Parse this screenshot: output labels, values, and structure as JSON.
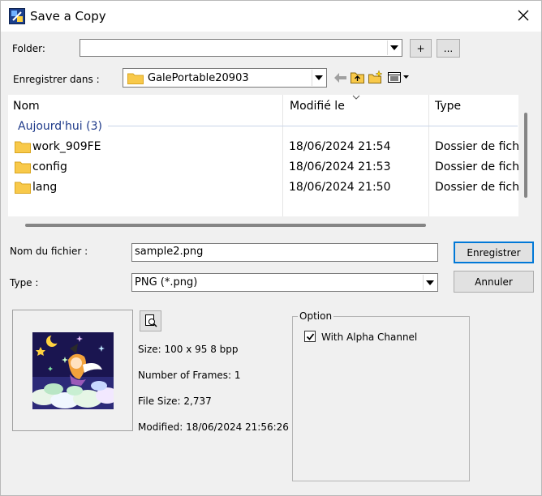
{
  "window": {
    "title": "Save a Copy"
  },
  "folder": {
    "label": "Folder:",
    "value": "",
    "add_label": "+",
    "browse_label": "..."
  },
  "save_in": {
    "label": "Enregistrer dans :",
    "value": "GalePortable20903"
  },
  "file_list": {
    "columns": [
      "Nom",
      "Modifié le",
      "Type"
    ],
    "group_header": "Aujourd'hui (3)",
    "rows": [
      {
        "name": "work_909FE",
        "modified": "18/06/2024 21:54",
        "type": "Dossier de fichi"
      },
      {
        "name": "config",
        "modified": "18/06/2024 21:53",
        "type": "Dossier de fichi"
      },
      {
        "name": "lang",
        "modified": "18/06/2024 21:50",
        "type": "Dossier de fichi"
      }
    ]
  },
  "filename": {
    "label": "Nom du fichier :",
    "value": "sample2.png"
  },
  "filetype": {
    "label": "Type :",
    "value": "PNG (*.png)"
  },
  "buttons": {
    "save": "Enregistrer",
    "cancel": "Annuler"
  },
  "preview": {
    "size": "Size: 100 x 95  8 bpp",
    "frames": "Number of Frames: 1",
    "file_size": "File Size: 2,737",
    "modified": "Modified: 18/06/2024 21:56:26"
  },
  "option": {
    "title": "Option",
    "alpha_label": "With Alpha Channel",
    "alpha_checked": true
  },
  "icons": [
    "app-icon",
    "close-icon",
    "folder-icon",
    "back-icon",
    "up-folder-icon",
    "new-folder-icon",
    "view-menu-icon",
    "preview-zoom-icon",
    "check-icon"
  ],
  "colors": {
    "accent": "#0078d7",
    "group_header": "#1e3a8a",
    "folder": "#f8c94a"
  }
}
